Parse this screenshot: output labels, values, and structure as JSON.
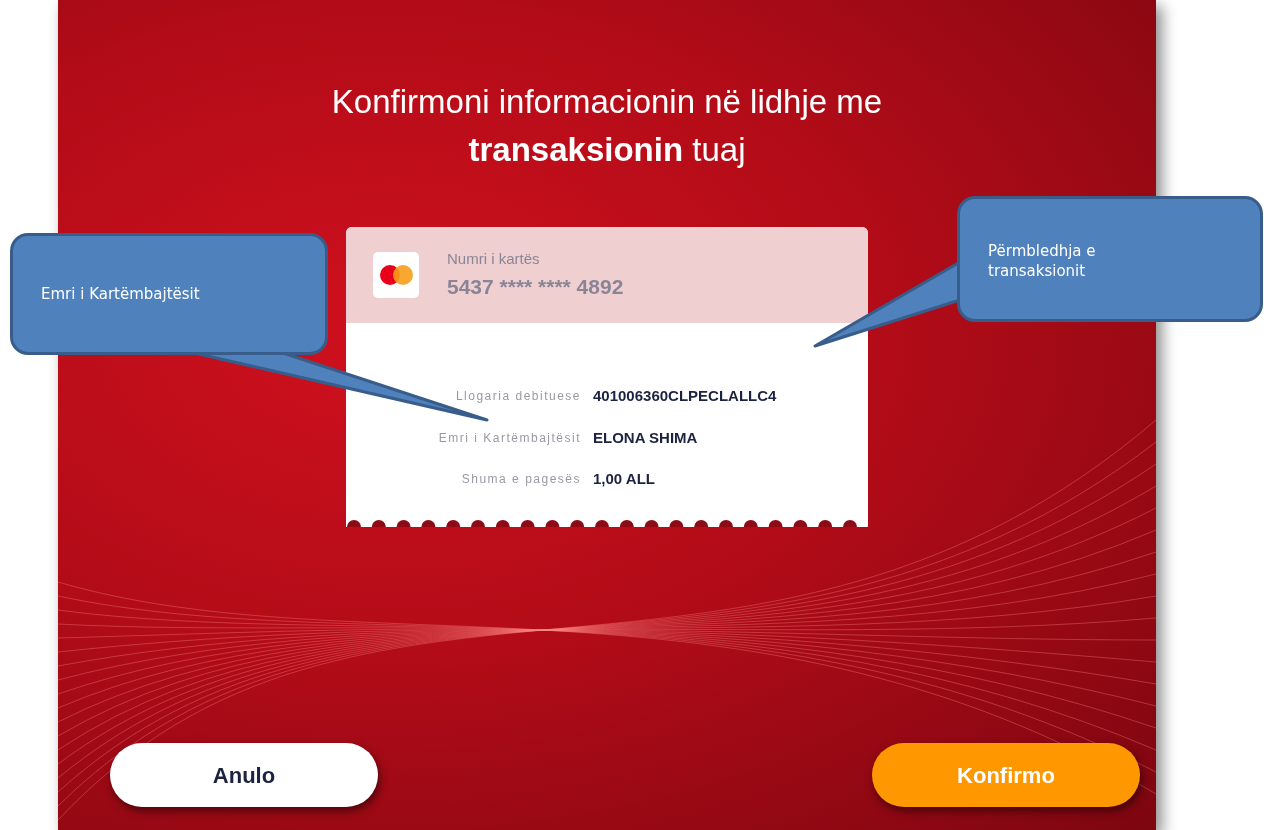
{
  "title": "Konfirmoni informacionin në lidhje me **transaksionin** tuaj",
  "card": {
    "label": "Numri i kartës",
    "number": "5437 **** **** 4892"
  },
  "details": [
    {
      "label": "Llogaria debituese",
      "value": "401006360CLPECLALLC4"
    },
    {
      "label": "Emri i Kartëmbajtësit",
      "value": "ELONA SHIMA"
    },
    {
      "label": "Shuma e pagesës",
      "value": "1,00 ALL"
    }
  ],
  "buttons": [
    {
      "label": "Anulo",
      "kind": "secondary"
    },
    {
      "label": "Konfirmo",
      "kind": "primary"
    }
  ],
  "callouts": [
    {
      "text": "Emri i Kartëmbajtësit"
    },
    {
      "text": "Përmbledhja e transaksionit"
    }
  ]
}
